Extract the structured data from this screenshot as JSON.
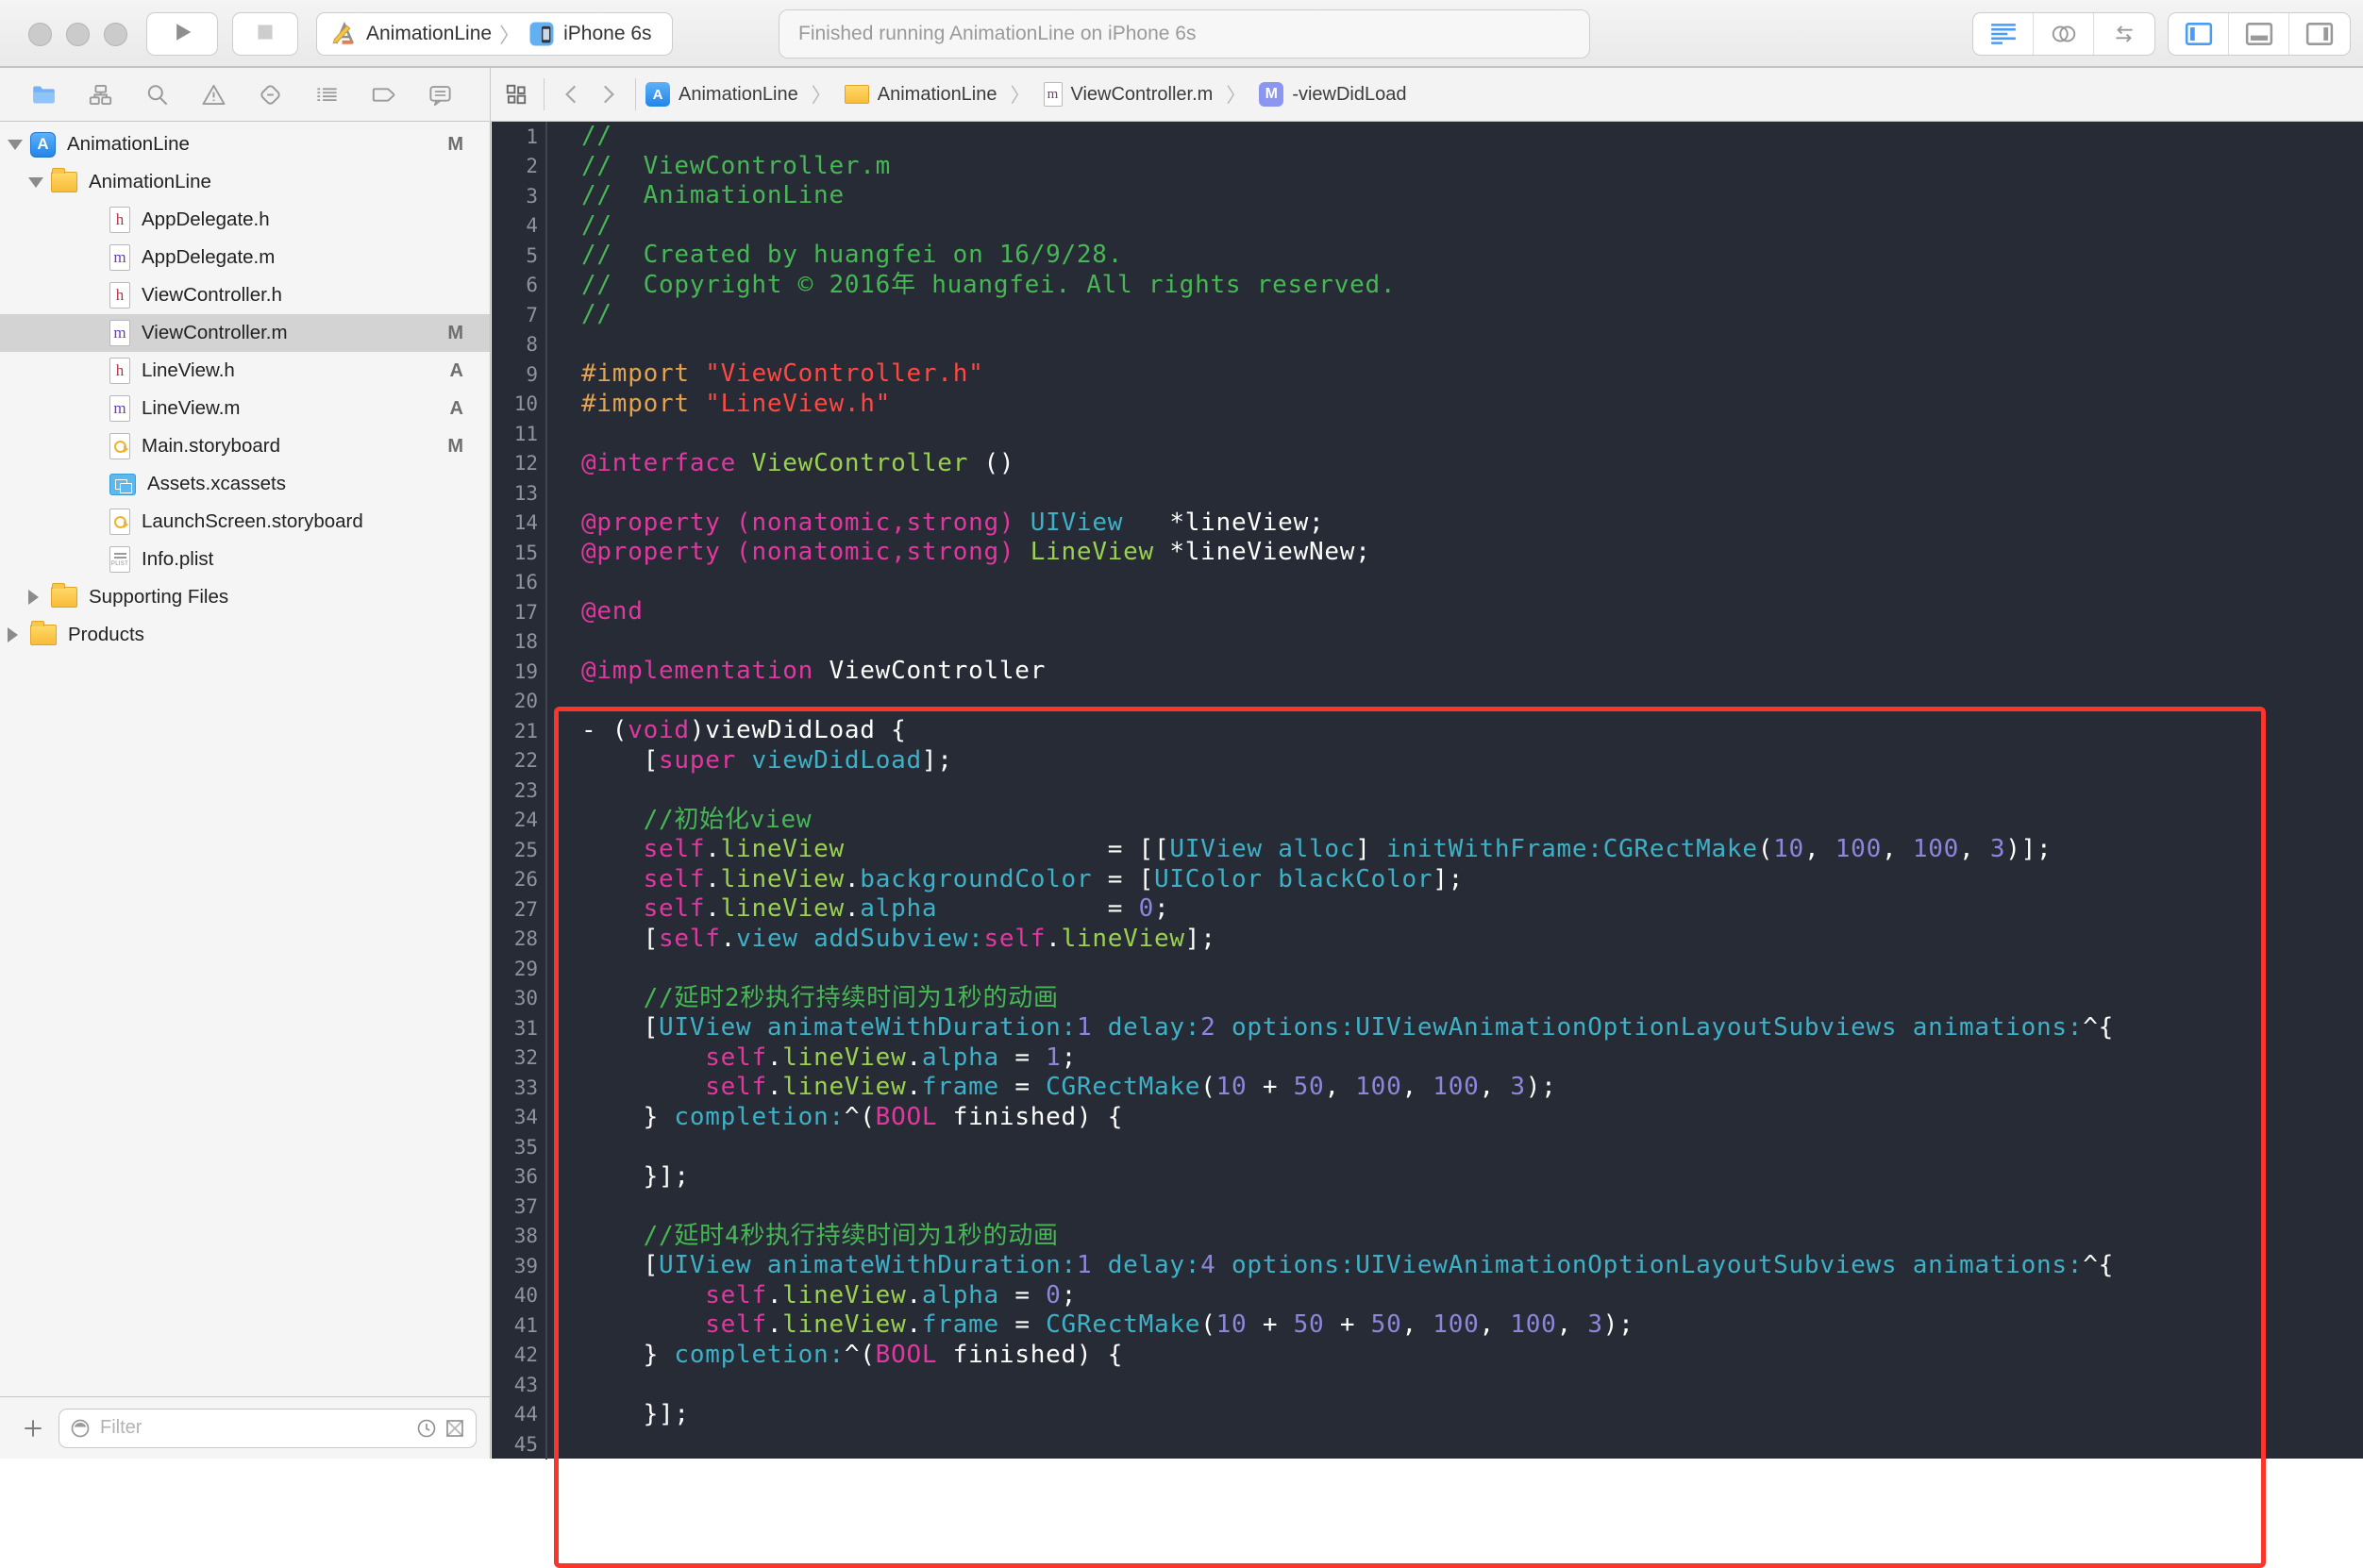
{
  "colors": {
    "accent_blue": "#4a9bf6",
    "editor_background": "#272b35",
    "annotation_red": "#fb352c",
    "comment_green": "#47b755",
    "keyword_pink": "#e038a0",
    "type_cyan": "#3eb1c8",
    "class_green": "#9ad150",
    "number_purple": "#8c86dc",
    "string_red": "#ff4842",
    "preprocessor_orange": "#e2a350"
  },
  "titlebar": {
    "traffic_lights": [
      "close",
      "minimize",
      "zoom"
    ],
    "run_button_icon": "play",
    "stop_button_icon": "stop",
    "scheme": {
      "app_icon": "scheme-app",
      "target": "AnimationLine",
      "separator": "〉",
      "device_icon": "scheme-device",
      "device": "iPhone 6s"
    },
    "status_text": "Finished running AnimationLine on iPhone 6s",
    "editor_buttons": [
      {
        "name": "standard-editor",
        "active": true
      },
      {
        "name": "assistant-editor",
        "active": false
      },
      {
        "name": "version-editor",
        "active": false
      }
    ],
    "view_buttons": [
      {
        "name": "panel-left",
        "active": true
      },
      {
        "name": "panel-bottom",
        "active": false
      },
      {
        "name": "panel-right",
        "active": false
      }
    ]
  },
  "navigator": {
    "tool_icons": [
      {
        "name": "project-navigator",
        "active": true
      },
      {
        "name": "symbol-navigator",
        "active": false
      },
      {
        "name": "find-navigator",
        "active": false
      },
      {
        "name": "issue-navigator",
        "active": false
      },
      {
        "name": "test-navigator",
        "active": false
      },
      {
        "name": "debug-navigator",
        "active": false
      },
      {
        "name": "breakpoint-navigator",
        "active": false
      },
      {
        "name": "report-navigator",
        "active": false
      }
    ],
    "files": [
      {
        "label": "AnimationLine",
        "type": "project",
        "level": 0,
        "disclosure": "open",
        "badge": "M"
      },
      {
        "label": "AnimationLine",
        "type": "folder",
        "level": 1,
        "disclosure": "open",
        "badge": ""
      },
      {
        "label": "AppDelegate.h",
        "type": "h",
        "level": 2,
        "badge": ""
      },
      {
        "label": "AppDelegate.m",
        "type": "m",
        "level": 2,
        "badge": ""
      },
      {
        "label": "ViewController.h",
        "type": "h",
        "level": 2,
        "badge": ""
      },
      {
        "label": "ViewController.m",
        "type": "m",
        "level": 2,
        "badge": "M",
        "selected": true
      },
      {
        "label": "LineView.h",
        "type": "h",
        "level": 2,
        "badge": "A"
      },
      {
        "label": "LineView.m",
        "type": "m",
        "level": 2,
        "badge": "A"
      },
      {
        "label": "Main.storyboard",
        "type": "storyboard",
        "level": 2,
        "badge": "M"
      },
      {
        "label": "Assets.xcassets",
        "type": "assets",
        "level": 2,
        "badge": ""
      },
      {
        "label": "LaunchScreen.storyboard",
        "type": "storyboard",
        "level": 2,
        "badge": ""
      },
      {
        "label": "Info.plist",
        "type": "plist",
        "level": 2,
        "badge": ""
      },
      {
        "label": "Supporting Files",
        "type": "folder",
        "level": 1,
        "disclosure": "closed",
        "badge": ""
      },
      {
        "label": "Products",
        "type": "folder",
        "level": 0,
        "disclosure": "closed",
        "badge": ""
      }
    ],
    "filter_placeholder": "Filter"
  },
  "jump_bar": {
    "related_items_icon": "related-items",
    "back_icon": "chevron-left",
    "forward_icon": "chevron-right",
    "separator": "〉",
    "breadcrumb": [
      {
        "icon": "app-project",
        "label": "AnimationLine"
      },
      {
        "icon": "folder-small",
        "label": "AnimationLine"
      },
      {
        "icon": "objc-file",
        "label": "ViewController.m"
      },
      {
        "icon": "method-chip",
        "label": "-viewDidLoad"
      }
    ]
  },
  "editor": {
    "annotation": {
      "kind": "red-rectangle",
      "first_line": 21,
      "last_line": 45
    },
    "lines": [
      [
        [
          "//",
          "c"
        ]
      ],
      [
        [
          "//  ViewController.m",
          "c"
        ]
      ],
      [
        [
          "//  AnimationLine",
          "c"
        ]
      ],
      [
        [
          "//",
          "c"
        ]
      ],
      [
        [
          "//  Created by huangfei on 16/9/28.",
          "c"
        ]
      ],
      [
        [
          "//  Copyright © 2016年 huangfei. All rights reserved.",
          "c"
        ]
      ],
      [
        [
          "//",
          "c"
        ]
      ],
      [],
      [
        [
          "#import ",
          "o"
        ],
        [
          "\"ViewController.h\"",
          "s"
        ]
      ],
      [
        [
          "#import ",
          "o"
        ],
        [
          "\"LineView.h\"",
          "s"
        ]
      ],
      [],
      [
        [
          "@interface",
          "k"
        ],
        [
          " ",
          "p"
        ],
        [
          "ViewController",
          "g"
        ],
        [
          " ()",
          "p"
        ]
      ],
      [],
      [
        [
          "@property",
          "k"
        ],
        [
          " ",
          "p"
        ],
        [
          "(nonatomic,strong)",
          "k"
        ],
        [
          " ",
          "p"
        ],
        [
          "UIView",
          "t"
        ],
        [
          "   *lineView;",
          "p"
        ]
      ],
      [
        [
          "@property",
          "k"
        ],
        [
          " ",
          "p"
        ],
        [
          "(nonatomic,strong)",
          "k"
        ],
        [
          " ",
          "p"
        ],
        [
          "LineView",
          "g"
        ],
        [
          " *lineViewNew;",
          "p"
        ]
      ],
      [],
      [
        [
          "@end",
          "k"
        ]
      ],
      [],
      [
        [
          "@implementation",
          "k"
        ],
        [
          " ViewController",
          "p"
        ]
      ],
      [],
      [
        [
          "- (",
          "p"
        ],
        [
          "void",
          "k"
        ],
        [
          ")viewDidLoad {",
          "p"
        ]
      ],
      [
        [
          "    [",
          "p"
        ],
        [
          "super",
          "k"
        ],
        [
          " ",
          "p"
        ],
        [
          "viewDidLoad",
          "t"
        ],
        [
          "];",
          "p"
        ]
      ],
      [],
      [
        [
          "    ",
          "p"
        ],
        [
          "//初始化view",
          "c"
        ]
      ],
      [
        [
          "    ",
          "p"
        ],
        [
          "self",
          "k"
        ],
        [
          ".",
          "p"
        ],
        [
          "lineView",
          "g"
        ],
        [
          "                 = [[",
          "p"
        ],
        [
          "UIView",
          "t"
        ],
        [
          " ",
          "p"
        ],
        [
          "alloc",
          "t"
        ],
        [
          "] ",
          "p"
        ],
        [
          "initWithFrame:",
          "t"
        ],
        [
          "CGRectMake",
          "t"
        ],
        [
          "(",
          "p"
        ],
        [
          "10",
          "n"
        ],
        [
          ", ",
          "p"
        ],
        [
          "100",
          "n"
        ],
        [
          ", ",
          "p"
        ],
        [
          "100",
          "n"
        ],
        [
          ", ",
          "p"
        ],
        [
          "3",
          "n"
        ],
        [
          ")];",
          "p"
        ]
      ],
      [
        [
          "    ",
          "p"
        ],
        [
          "self",
          "k"
        ],
        [
          ".",
          "p"
        ],
        [
          "lineView",
          "g"
        ],
        [
          ".",
          "p"
        ],
        [
          "backgroundColor",
          "t"
        ],
        [
          " = [",
          "p"
        ],
        [
          "UIColor",
          "t"
        ],
        [
          " ",
          "p"
        ],
        [
          "blackColor",
          "t"
        ],
        [
          "];",
          "p"
        ]
      ],
      [
        [
          "    ",
          "p"
        ],
        [
          "self",
          "k"
        ],
        [
          ".",
          "p"
        ],
        [
          "lineView",
          "g"
        ],
        [
          ".",
          "p"
        ],
        [
          "alpha",
          "t"
        ],
        [
          "           = ",
          "p"
        ],
        [
          "0",
          "n"
        ],
        [
          ";",
          "p"
        ]
      ],
      [
        [
          "    [",
          "p"
        ],
        [
          "self",
          "k"
        ],
        [
          ".",
          "p"
        ],
        [
          "view",
          "t"
        ],
        [
          " ",
          "p"
        ],
        [
          "addSubview:",
          "t"
        ],
        [
          "self",
          "k"
        ],
        [
          ".",
          "p"
        ],
        [
          "lineView",
          "g"
        ],
        [
          "];",
          "p"
        ]
      ],
      [],
      [
        [
          "    ",
          "p"
        ],
        [
          "//延时2秒执行持续时间为1秒的动画",
          "c"
        ]
      ],
      [
        [
          "    [",
          "p"
        ],
        [
          "UIView",
          "t"
        ],
        [
          " ",
          "p"
        ],
        [
          "animateWithDuration:",
          "t"
        ],
        [
          "1",
          "n"
        ],
        [
          " ",
          "p"
        ],
        [
          "delay:",
          "t"
        ],
        [
          "2",
          "n"
        ],
        [
          " ",
          "p"
        ],
        [
          "options:",
          "t"
        ],
        [
          "UIViewAnimationOptionLayoutSubviews",
          "t"
        ],
        [
          " ",
          "p"
        ],
        [
          "animations:",
          "t"
        ],
        [
          "^{",
          "p"
        ]
      ],
      [
        [
          "        ",
          "p"
        ],
        [
          "self",
          "k"
        ],
        [
          ".",
          "p"
        ],
        [
          "lineView",
          "g"
        ],
        [
          ".",
          "p"
        ],
        [
          "alpha",
          "t"
        ],
        [
          " = ",
          "p"
        ],
        [
          "1",
          "n"
        ],
        [
          ";",
          "p"
        ]
      ],
      [
        [
          "        ",
          "p"
        ],
        [
          "self",
          "k"
        ],
        [
          ".",
          "p"
        ],
        [
          "lineView",
          "g"
        ],
        [
          ".",
          "p"
        ],
        [
          "frame",
          "t"
        ],
        [
          " = ",
          "p"
        ],
        [
          "CGRectMake",
          "t"
        ],
        [
          "(",
          "p"
        ],
        [
          "10",
          "n"
        ],
        [
          " + ",
          "p"
        ],
        [
          "50",
          "n"
        ],
        [
          ", ",
          "p"
        ],
        [
          "100",
          "n"
        ],
        [
          ", ",
          "p"
        ],
        [
          "100",
          "n"
        ],
        [
          ", ",
          "p"
        ],
        [
          "3",
          "n"
        ],
        [
          ");",
          "p"
        ]
      ],
      [
        [
          "    } ",
          "p"
        ],
        [
          "completion:",
          "t"
        ],
        [
          "^(",
          "p"
        ],
        [
          "BOOL",
          "k"
        ],
        [
          " finished) {",
          "p"
        ]
      ],
      [],
      [
        [
          "    }];",
          "p"
        ]
      ],
      [],
      [
        [
          "    ",
          "p"
        ],
        [
          "//延时4秒执行持续时间为1秒的动画",
          "c"
        ]
      ],
      [
        [
          "    [",
          "p"
        ],
        [
          "UIView",
          "t"
        ],
        [
          " ",
          "p"
        ],
        [
          "animateWithDuration:",
          "t"
        ],
        [
          "1",
          "n"
        ],
        [
          " ",
          "p"
        ],
        [
          "delay:",
          "t"
        ],
        [
          "4",
          "n"
        ],
        [
          " ",
          "p"
        ],
        [
          "options:",
          "t"
        ],
        [
          "UIViewAnimationOptionLayoutSubviews",
          "t"
        ],
        [
          " ",
          "p"
        ],
        [
          "animations:",
          "t"
        ],
        [
          "^{",
          "p"
        ]
      ],
      [
        [
          "        ",
          "p"
        ],
        [
          "self",
          "k"
        ],
        [
          ".",
          "p"
        ],
        [
          "lineView",
          "g"
        ],
        [
          ".",
          "p"
        ],
        [
          "alpha",
          "t"
        ],
        [
          " = ",
          "p"
        ],
        [
          "0",
          "n"
        ],
        [
          ";",
          "p"
        ]
      ],
      [
        [
          "        ",
          "p"
        ],
        [
          "self",
          "k"
        ],
        [
          ".",
          "p"
        ],
        [
          "lineView",
          "g"
        ],
        [
          ".",
          "p"
        ],
        [
          "frame",
          "t"
        ],
        [
          " = ",
          "p"
        ],
        [
          "CGRectMake",
          "t"
        ],
        [
          "(",
          "p"
        ],
        [
          "10",
          "n"
        ],
        [
          " + ",
          "p"
        ],
        [
          "50",
          "n"
        ],
        [
          " + ",
          "p"
        ],
        [
          "50",
          "n"
        ],
        [
          ", ",
          "p"
        ],
        [
          "100",
          "n"
        ],
        [
          ", ",
          "p"
        ],
        [
          "100",
          "n"
        ],
        [
          ", ",
          "p"
        ],
        [
          "3",
          "n"
        ],
        [
          ");",
          "p"
        ]
      ],
      [
        [
          "    } ",
          "p"
        ],
        [
          "completion:",
          "t"
        ],
        [
          "^(",
          "p"
        ],
        [
          "BOOL",
          "k"
        ],
        [
          " finished) {",
          "p"
        ]
      ],
      [],
      [
        [
          "    }];",
          "p"
        ]
      ],
      []
    ]
  }
}
